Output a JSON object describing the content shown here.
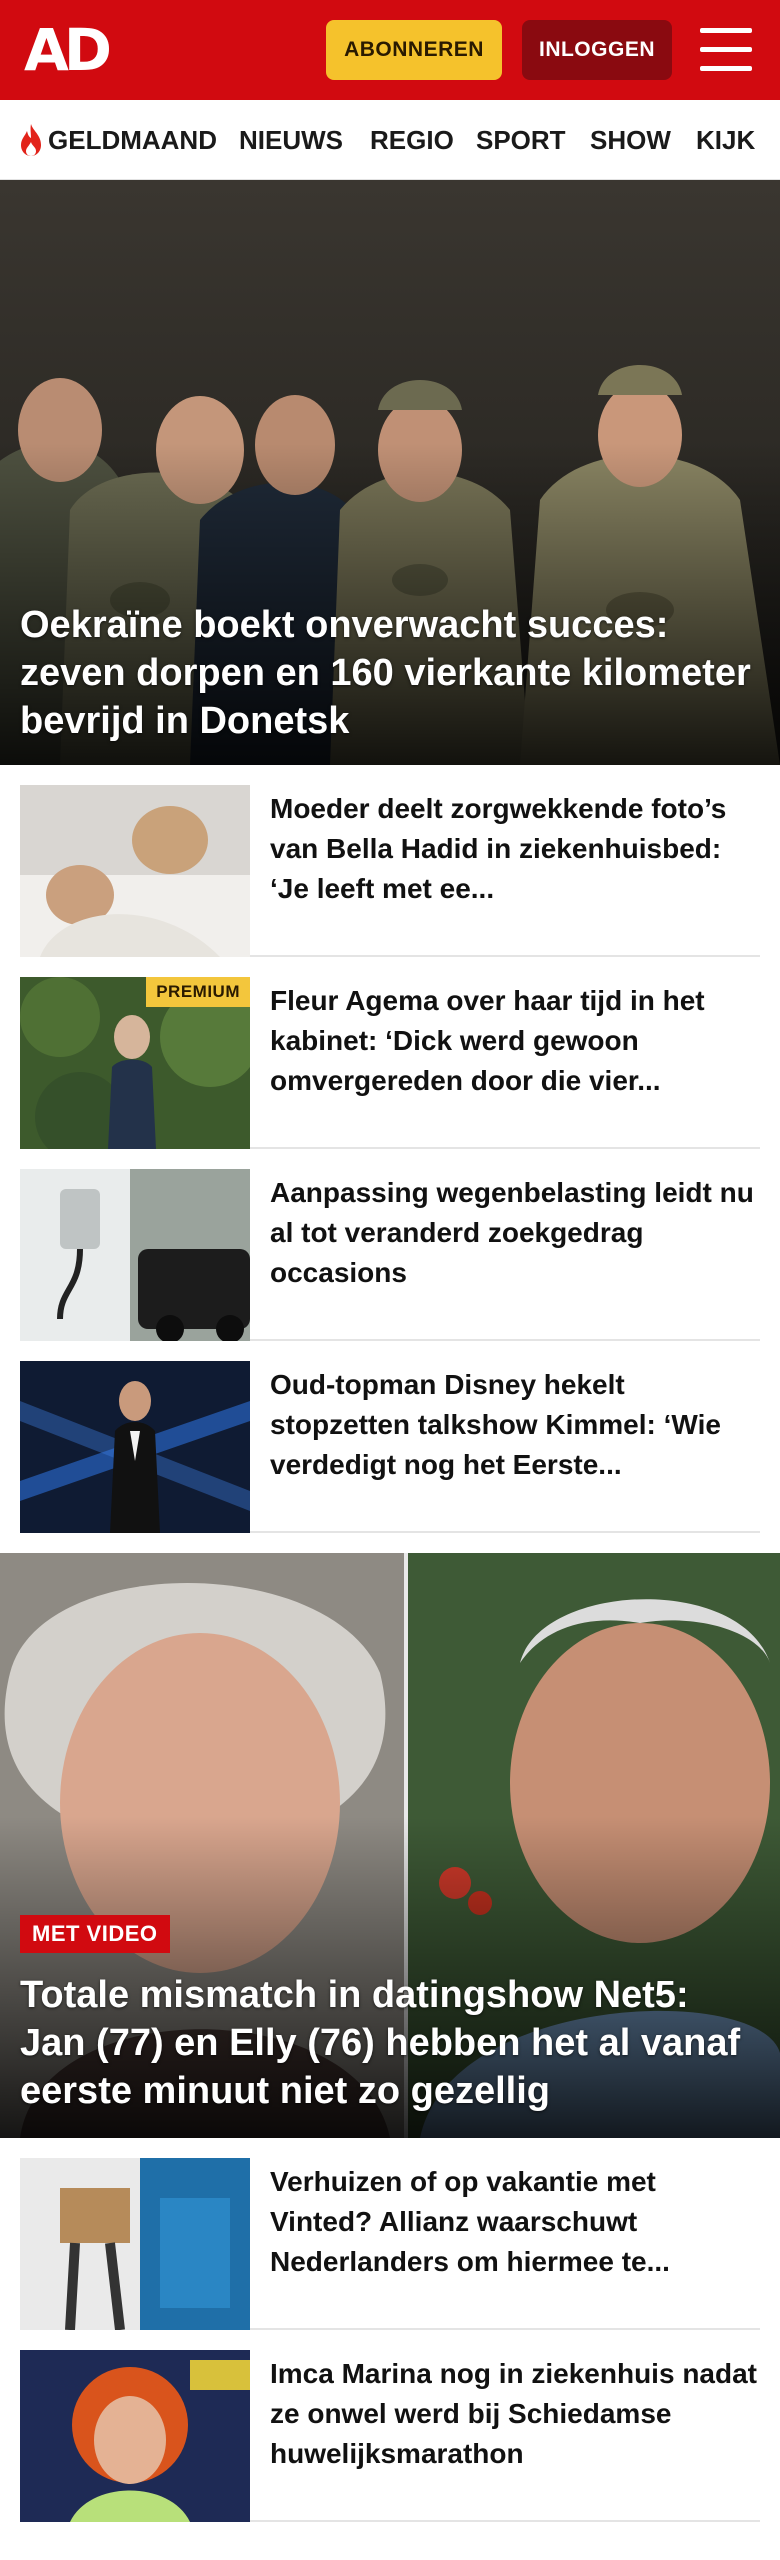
{
  "header": {
    "logo": "AD",
    "subscribe_label": "ABONNEREN",
    "login_label": "INLOGGEN",
    "brand_color": "#d10a10",
    "subscribe_color": "#f5c22c"
  },
  "nav": {
    "items": [
      {
        "label": "GELDMAAND",
        "icon": "flame-icon"
      },
      {
        "label": "NIEUWS"
      },
      {
        "label": "REGIO"
      },
      {
        "label": "SPORT"
      },
      {
        "label": "SHOW"
      },
      {
        "label": "KIJK"
      }
    ]
  },
  "hero": {
    "title": "Oekraïne boekt onverwacht succes: zeven dorpen en 160 vierkante kilometer bevrijd in Donetsk"
  },
  "articles": [
    {
      "title": "Moeder deelt zorgwekkende foto’s van Bella Hadid in ziekenhuisbed: ‘Je leeft met ee..."
    },
    {
      "title": "Fleur Agema over haar tijd in het kabinet: ‘Dick werd gewoon omvergereden door die vier...",
      "badge": "PREMIUM"
    },
    {
      "title": "Aanpassing wegenbelasting leidt nu al tot veranderd zoekgedrag occasions"
    },
    {
      "title": "Oud-topman Disney hekelt stopzetten talkshow Kimmel: ‘Wie verdedigt nog het Eerste..."
    }
  ],
  "feature": {
    "badge": "MET VIDEO",
    "title": "Totale mismatch in datingshow Net5: Jan (77) en Elly (76) hebben het al vanaf eerste minuut niet zo gezellig"
  },
  "articles2": [
    {
      "title": "Verhuizen of op vakantie met Vinted? Allianz waarschuwt Nederlanders om hiermee te..."
    },
    {
      "title": "Imca Marina nog in ziekenhuis nadat ze onwel werd bij Schiedamse huwelijksmarathon"
    }
  ]
}
